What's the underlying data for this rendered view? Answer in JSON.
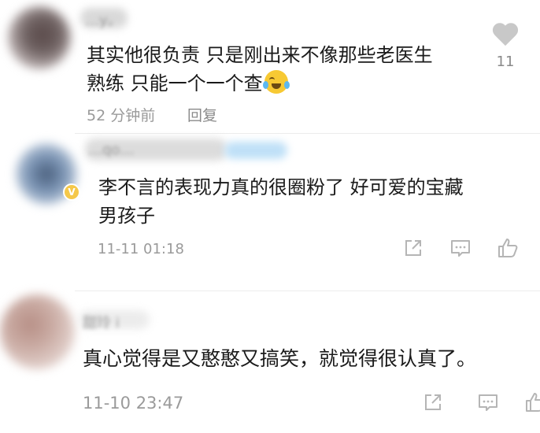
{
  "comments": [
    {
      "username": "…y。",
      "text_line1": "其实他很负责 只是刚出来不像那些老医生",
      "text_line2": "熟练 只能一个一个查",
      "emoji": "laugh-cry-emoji",
      "time": "52 分钟前",
      "reply_label": "回复",
      "like_count": "11"
    },
    {
      "username": "…qo…",
      "text_line1": "李不言的表现力真的很圈粉了   好可爱的宝藏",
      "text_line2": "男孩子",
      "time": "11-11 01:18",
      "badge": "V"
    },
    {
      "username": "甜玲 i",
      "text_line1": "真心觉得是又憨憨又搞笑，就觉得很认真了。",
      "time": "11-10 23:47"
    }
  ],
  "icons": {
    "heart": "heart-icon",
    "share": "share-icon",
    "comment": "comment-icon",
    "like": "thumbs-up-icon"
  },
  "colors": {
    "text": "#1a1a1a",
    "meta": "#9a9a9a",
    "icon": "#b5b5b5",
    "badge": "#f5c84a"
  }
}
